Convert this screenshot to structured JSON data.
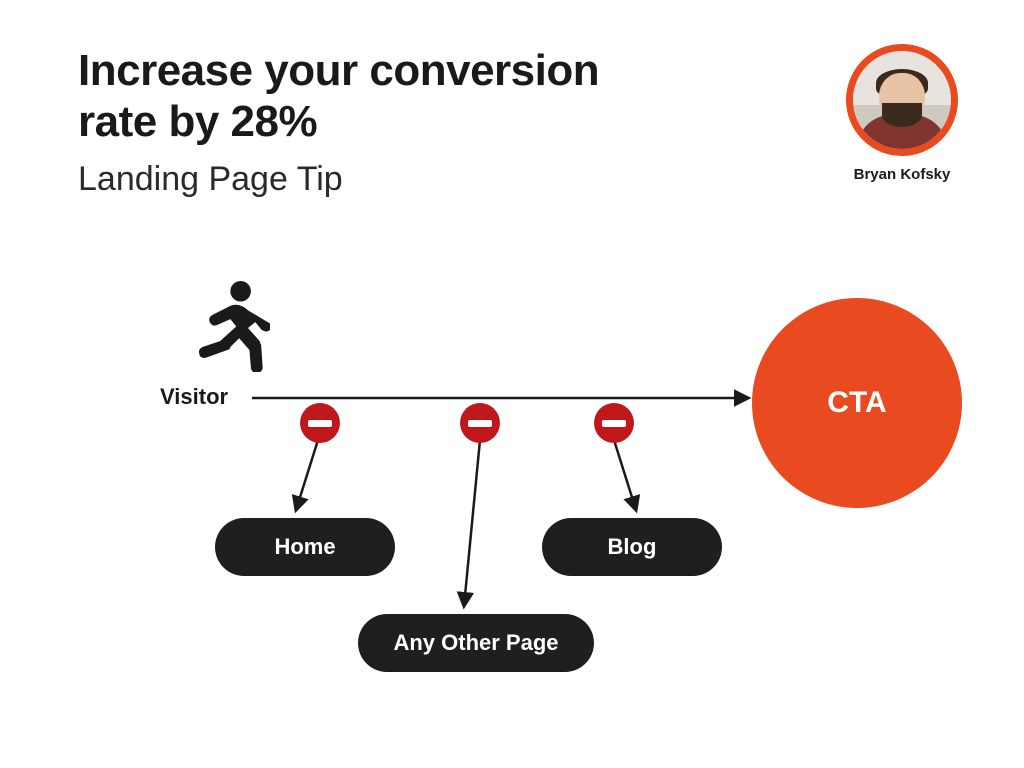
{
  "header": {
    "title_line1": "Increase your conversion",
    "title_line2": "rate by 28%",
    "subtitle": "Landing Page Tip"
  },
  "author": {
    "name": "Bryan Kofsky"
  },
  "diagram": {
    "start_label": "Visitor",
    "goal_label": "CTA",
    "blocked_routes": [
      "Home",
      "Any Other Page",
      "Blog"
    ]
  },
  "colors": {
    "accent": "#ea4a1f",
    "stop": "#c0171a",
    "pill": "#1f1f1f"
  }
}
